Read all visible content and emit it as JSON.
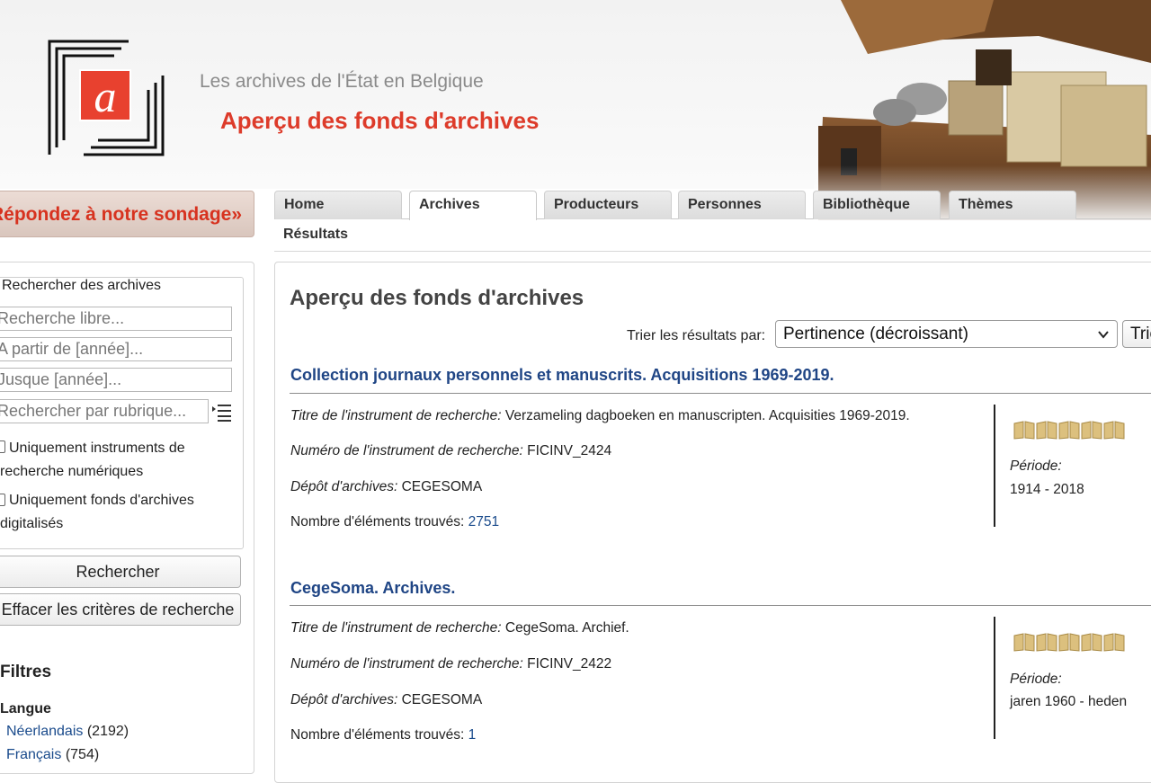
{
  "header": {
    "site_name": "Les archives de l'État en Belgique",
    "site_subtitle": "Aperçu des fonds d'archives",
    "logo_letter": "a"
  },
  "survey": {
    "label": "Répondez à notre sondage»"
  },
  "tabs": [
    {
      "label": "Home",
      "active": false
    },
    {
      "label": "Archives",
      "active": true
    },
    {
      "label": "Producteurs",
      "active": false
    },
    {
      "label": "Personnes",
      "active": false
    },
    {
      "label": "Bibliothèque",
      "active": false
    },
    {
      "label": "Thèmes",
      "active": false
    }
  ],
  "subnav": {
    "label": "Résultats"
  },
  "search": {
    "legend": "Rechercher des archives",
    "free_text_placeholder": "Recherche libre...",
    "from_year_placeholder": "A partir de [année]...",
    "to_year_placeholder": "Jusque [année]...",
    "rubric_placeholder": "Rechercher par rubrique...",
    "checkbox_digital_instruments": "Uniquement instruments de recherche numériques",
    "checkbox_digitized_fonds": "Uniquement fonds d'archives digitalisés",
    "search_button": "Rechercher",
    "clear_button": "Effacer les critères de recherche"
  },
  "filters": {
    "title": "Filtres",
    "language_group": "Langue",
    "items": [
      {
        "label": "Néerlandais",
        "count": "(2192)"
      },
      {
        "label": "Français",
        "count": "(754)"
      }
    ]
  },
  "main": {
    "title": "Aperçu des fonds d'archives",
    "sort_label": "Trier les résultats par:",
    "sort_value": "Pertinence (décroissant)",
    "sort_button": "Trier"
  },
  "results": [
    {
      "title": "Collection journaux personnels et manuscrits. Acquisitions 1969-2019.",
      "instrument_title_label": "Titre de l'instrument de recherche:",
      "instrument_title": "Verzameling dagboeken en manuscripten. Acquisities 1969-2019.",
      "instrument_number_label": "Numéro de l'instrument de recherche:",
      "instrument_number": "FICINV_2424",
      "depot_label": "Dépôt d'archives:",
      "depot": "CEGESOMA",
      "count_label": "Nombre d'éléments trouvés:",
      "count": "2751",
      "period_label": "Période:",
      "period": "1914 - 2018"
    },
    {
      "title": "CegeSoma. Archives.",
      "instrument_title_label": "Titre de l'instrument de recherche:",
      "instrument_title": "CegeSoma. Archief.",
      "instrument_number_label": "Numéro de l'instrument de recherche:",
      "instrument_number": "FICINV_2422",
      "depot_label": "Dépôt d'archives:",
      "depot": "CEGESOMA",
      "count_label": "Nombre d'éléments trouvés:",
      "count": "1",
      "period_label": "Période:",
      "period": "jaren 1960 - heden"
    }
  ],
  "colors": {
    "accent_red": "#dd3b2a",
    "link_blue": "#1f4585",
    "rating_book": "#d9b872"
  },
  "icons": {
    "list": "list-icon",
    "chevron": "chevron-down-icon",
    "rating": "open-book-icon"
  }
}
